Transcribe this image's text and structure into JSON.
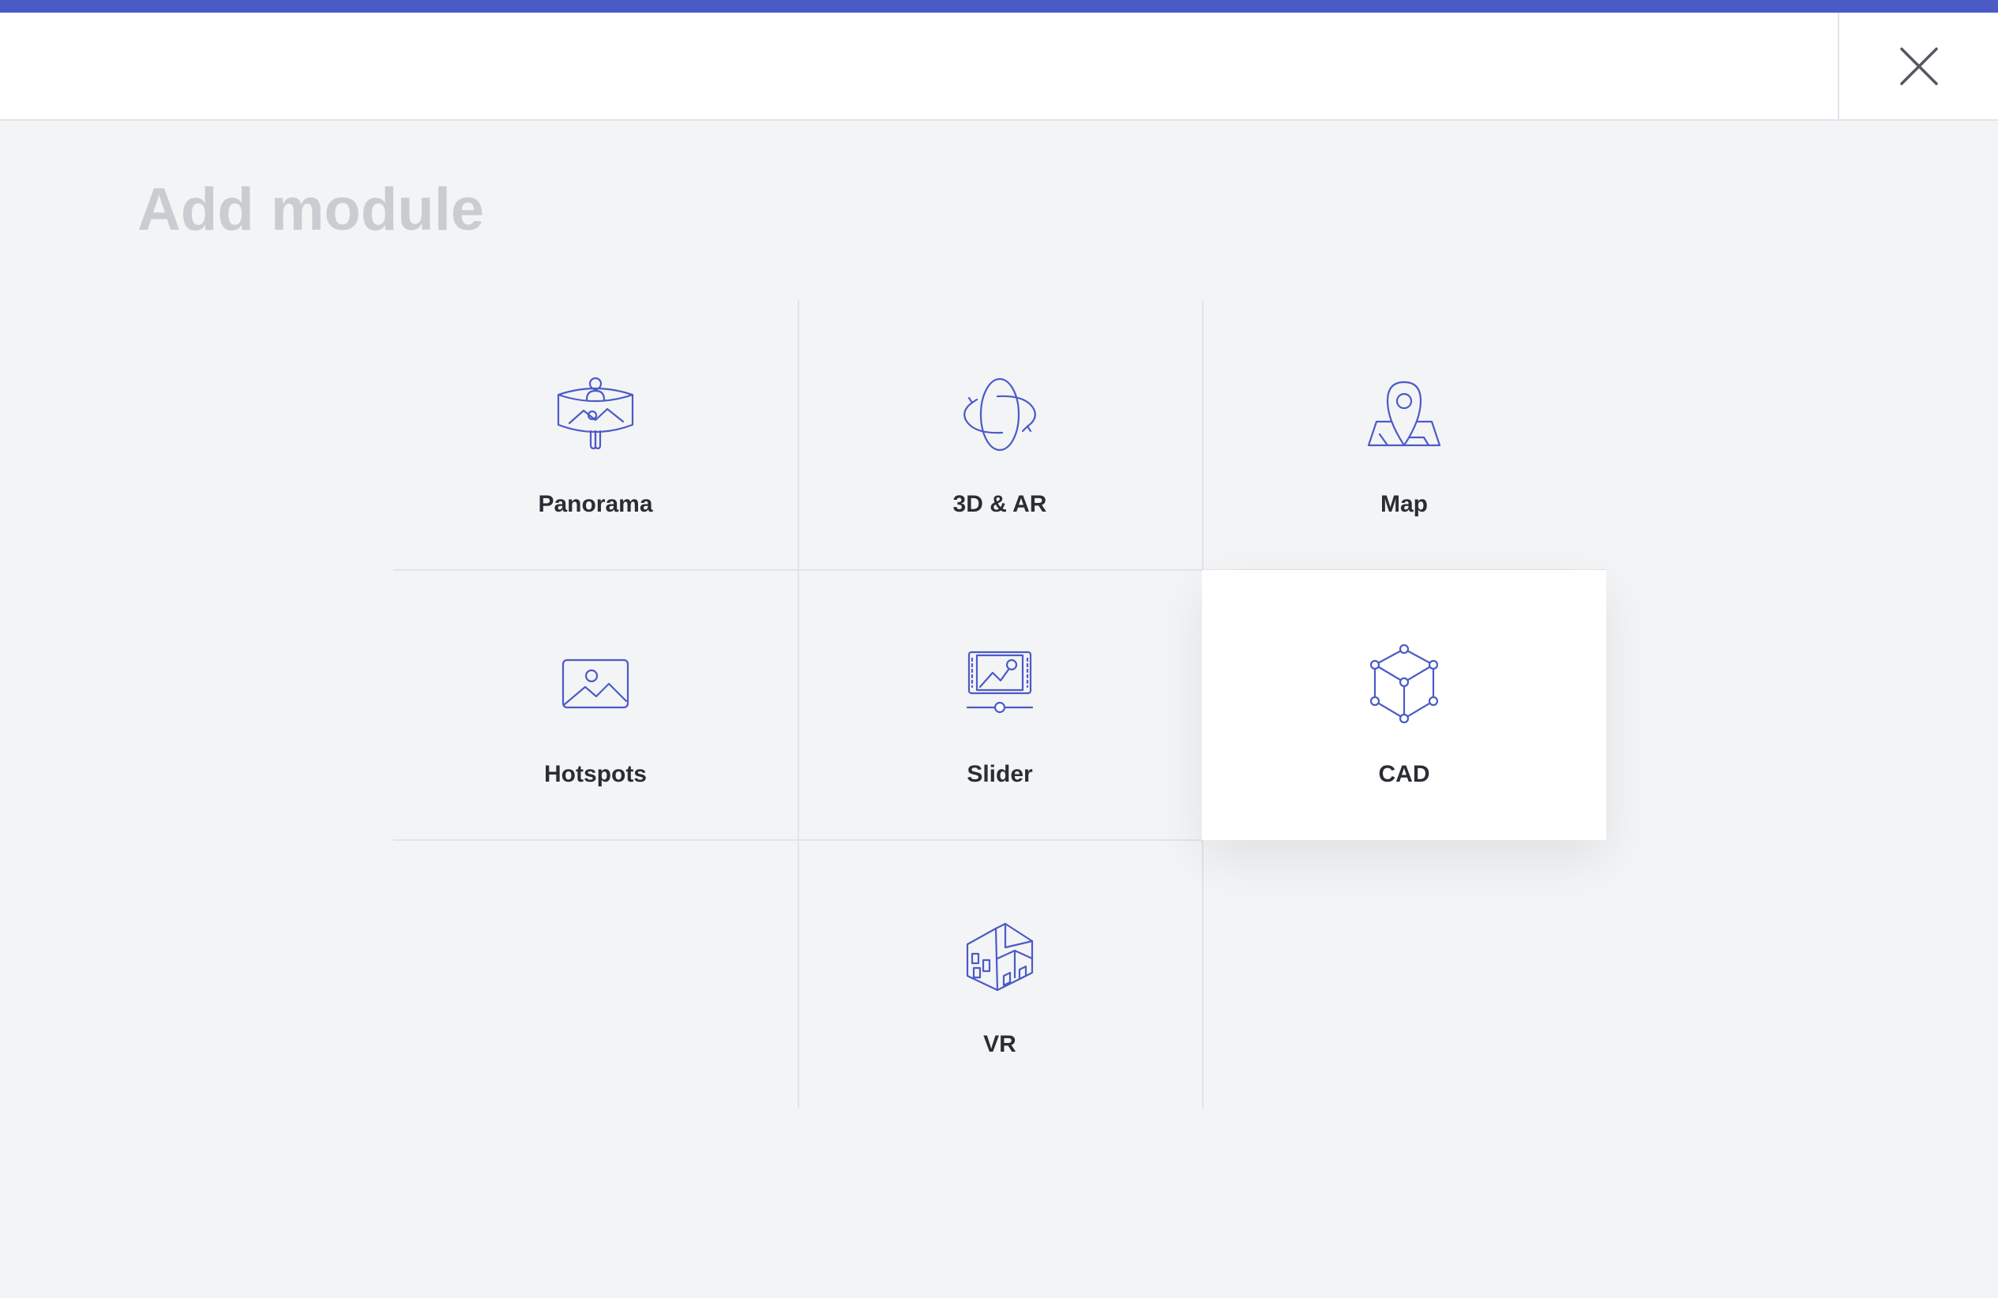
{
  "page": {
    "title": "Add module",
    "accent_color": "#4b5bc6"
  },
  "header": {
    "close_icon": "close-icon"
  },
  "modules": [
    {
      "label": "Panorama",
      "icon": "panorama-icon"
    },
    {
      "label": "3D & AR",
      "icon": "3d-ar-icon"
    },
    {
      "label": "Map",
      "icon": "map-pin-icon"
    },
    {
      "label": "Hotspots",
      "icon": "image-icon"
    },
    {
      "label": "Slider",
      "icon": "slider-icon"
    },
    {
      "label": "CAD",
      "icon": "cube-icon",
      "selected": true
    },
    {
      "label": "VR",
      "icon": "vr-building-icon"
    }
  ]
}
